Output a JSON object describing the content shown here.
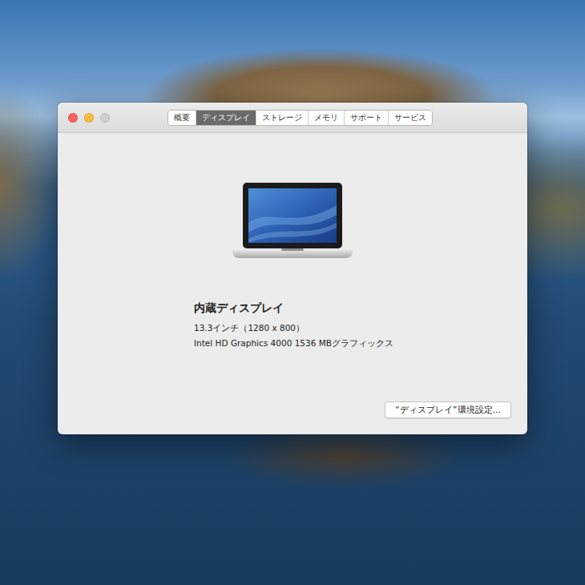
{
  "window": {
    "controls": [
      {
        "kind": "close",
        "disabled": false,
        "color": "#fc605c"
      },
      {
        "kind": "minimize",
        "disabled": false,
        "color": "#fdbc40"
      },
      {
        "kind": "zoom",
        "disabled": true,
        "color": "#cfcfcf"
      }
    ]
  },
  "tabs": [
    {
      "label": "概要",
      "selected": false
    },
    {
      "label": "ディスプレイ",
      "selected": true
    },
    {
      "label": "ストレージ",
      "selected": false
    },
    {
      "label": "メモリ",
      "selected": false
    },
    {
      "label": "サポート",
      "selected": false
    },
    {
      "label": "サービス",
      "selected": false
    }
  ],
  "display": {
    "name": "内蔵ディスプレイ",
    "size": "13.3インチ（1280 x 800）",
    "graphics": "Intel HD Graphics 4000 1536 MBグラフィックス"
  },
  "buttons": [
    "“ディスプレイ”環境設定..."
  ]
}
